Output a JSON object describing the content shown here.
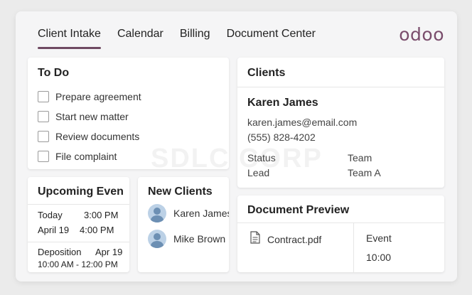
{
  "tabs": [
    "Client Intake",
    "Calendar",
    "Billing",
    "Document Center"
  ],
  "active_tab_index": 0,
  "logo_text": "odoo",
  "watermark": "SDLC CORP",
  "colors": {
    "accent": "#6f4a62",
    "logo": "#7a4d6c",
    "avatar": "#bcd1e6"
  },
  "todo": {
    "title": "To Do",
    "items": [
      "Prepare agreement",
      "Start new matter",
      "Review documents",
      "File complaint"
    ]
  },
  "clients": {
    "title": "Clients",
    "name": "Karen James",
    "email": "karen.james@email.com",
    "phone": "(555) 828-4202",
    "status_label": "Status",
    "status_value": "Lead",
    "team_label": "Team",
    "team_value": "Team A"
  },
  "upcoming": {
    "title": "Upcoming Even",
    "row1": {
      "day": "Today",
      "time": "3:00 PM",
      "date": "April 19",
      "time2": "4:00 PM"
    },
    "row2": {
      "title": "Deposition",
      "date": "Apr 19",
      "range": "10:00 AM - 12:00 PM"
    }
  },
  "new_clients": {
    "title": "New Clients",
    "items": [
      "Karen James",
      "Mike Brown"
    ]
  },
  "document_preview": {
    "title": "Document Preview",
    "file_icon": "document-icon",
    "file_name": "Contract.pdf",
    "event_label": "Event",
    "event_time": "10:00"
  }
}
